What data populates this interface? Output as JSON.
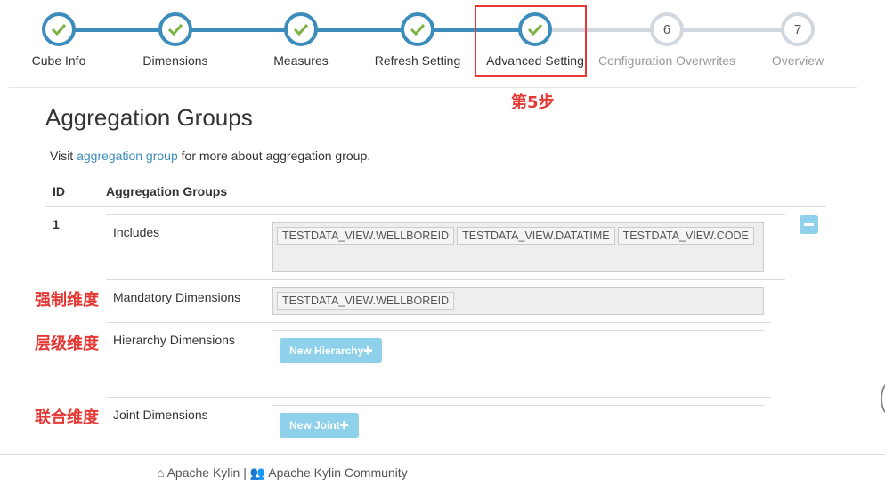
{
  "wizard": {
    "steps": [
      {
        "label": "Cube Info",
        "status": "done",
        "number": "1"
      },
      {
        "label": "Dimensions",
        "status": "done",
        "number": "2"
      },
      {
        "label": "Measures",
        "status": "done",
        "number": "3"
      },
      {
        "label": "Refresh Setting",
        "status": "done",
        "number": "4"
      },
      {
        "label": "Advanced Setting",
        "status": "done",
        "number": "5"
      },
      {
        "label": "Configuration Overwrites",
        "status": "pending",
        "number": "6"
      },
      {
        "label": "Overview",
        "status": "pending",
        "number": "7"
      }
    ],
    "annotation": "第5步"
  },
  "main": {
    "title": "Aggregation Groups",
    "visit_prefix": "Visit ",
    "visit_link": "aggregation group",
    "visit_suffix": " for more about aggregation group.",
    "table": {
      "col_id": "ID",
      "col_groups": "Aggregation Groups",
      "row_id": "1",
      "includes_label": "Includes",
      "includes_tags": [
        "TESTDATA_VIEW.WELLBOREID",
        "TESTDATA_VIEW.DATATIME",
        "TESTDATA_VIEW.CODE"
      ],
      "mandatory_label": "Mandatory Dimensions",
      "mandatory_tags": [
        "TESTDATA_VIEW.WELLBOREID"
      ],
      "hierarchy_label": "Hierarchy Dimensions",
      "new_hierarchy": "New Hierarchy",
      "joint_label": "Joint Dimensions",
      "new_joint": "New Joint"
    }
  },
  "annotations": {
    "mandatory": "强制维度",
    "hierarchy": "层级维度",
    "joint": "联合维度"
  },
  "footer": {
    "kylin": "Apache Kylin",
    "separator": " | ",
    "community": "Apache Kylin Community"
  },
  "colors": {
    "accent": "#3c8dbc",
    "check": "#7cb342",
    "pending": "#d2d6de",
    "annotation_red": "#e53935",
    "button_light": "#8fd1ea"
  }
}
